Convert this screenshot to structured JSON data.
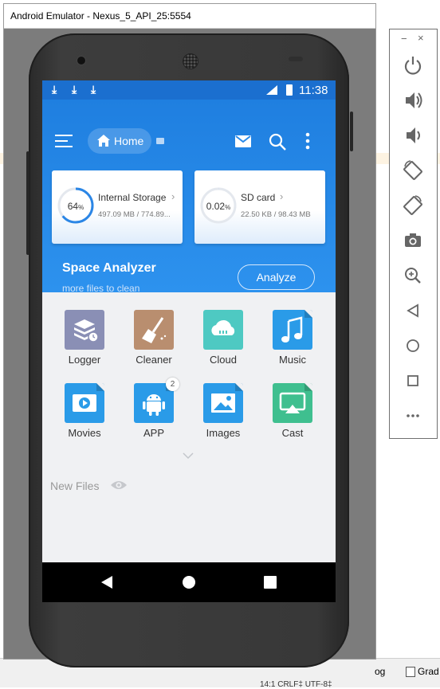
{
  "window": {
    "title": "Android Emulator - Nexus_5_API_25:5554"
  },
  "status_bar": {
    "time": "11:38",
    "download_icons": [
      "download-icon",
      "download-icon",
      "download-icon"
    ],
    "network": "LTE"
  },
  "app_bar": {
    "home_label": "Home",
    "icons": [
      "menu-icon",
      "home-icon",
      "mail-icon",
      "search-icon",
      "more-vertical-icon"
    ]
  },
  "storage_cards": [
    {
      "name": "Internal Storage",
      "percent": "64",
      "percent_suffix": "%",
      "usage": "497.09 MB / 774.89...",
      "fill_fraction": 0.64
    },
    {
      "name": "SD card",
      "percent": "0.02",
      "percent_suffix": "%",
      "usage": "22.50 KB / 98.43 MB",
      "fill_fraction": 0.0002
    }
  ],
  "space_analyzer": {
    "title": "Space Analyzer",
    "subtitle": "more files to clean",
    "button_label": "Analyze"
  },
  "categories": [
    {
      "label": "Logger",
      "icon": "logger-icon",
      "color": "#8a8fb5"
    },
    {
      "label": "Cleaner",
      "icon": "broom-icon",
      "color": "#b98e6f"
    },
    {
      "label": "Cloud",
      "icon": "cloud-icon",
      "color": "#4ec9c2"
    },
    {
      "label": "Music",
      "icon": "music-icon",
      "color": "#2a9be8"
    },
    {
      "label": "Movies",
      "icon": "movie-icon",
      "color": "#2a9be8"
    },
    {
      "label": "APP",
      "icon": "android-icon",
      "color": "#2a9be8",
      "badge": "2"
    },
    {
      "label": "Images",
      "icon": "image-icon",
      "color": "#2a9be8"
    },
    {
      "label": "Cast",
      "icon": "cast-icon",
      "color": "#3fbf8f"
    }
  ],
  "new_files": {
    "label": "New Files"
  },
  "nav_bar": {
    "icons": [
      "back-icon",
      "home-circle-icon",
      "recents-icon"
    ]
  },
  "emulator_toolbar": {
    "window_controls": [
      "−",
      "×"
    ],
    "buttons": [
      "power-icon",
      "volume-up-icon",
      "volume-down-icon",
      "rotate-left-icon",
      "rotate-right-icon",
      "camera-icon",
      "zoom-icon",
      "back-icon",
      "home-icon",
      "overview-icon",
      "more-icon"
    ]
  },
  "ide_background": {
    "log_tab": "og",
    "gradle_tab": "Grad",
    "status_text": "14:1   CRLF‡   UTF-8‡"
  }
}
